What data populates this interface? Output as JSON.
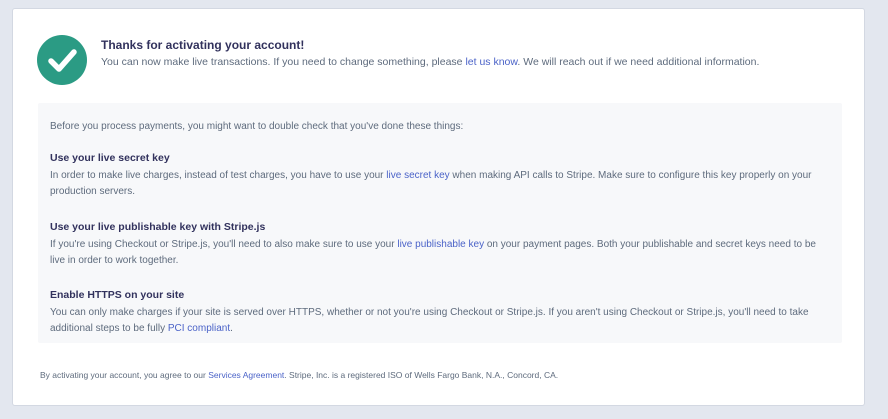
{
  "header": {
    "title": "Thanks for activating your account!",
    "subtitle_before": "You can now make live transactions. If you need to change something, please ",
    "subtitle_link": "let us know",
    "subtitle_after": ". We will reach out if we need additional information."
  },
  "checklist": {
    "intro": "Before you process payments, you might want to double check that you've done these things:",
    "items": [
      {
        "title": "Use your live secret key",
        "text_before": "In order to make live charges, instead of test charges, you have to use your ",
        "link": "live secret key",
        "text_after": " when making API calls to Stripe. Make sure to configure this key properly on your production servers."
      },
      {
        "title": "Use your live publishable key with Stripe.js",
        "text_before": "If you're using Checkout or Stripe.js, you'll need to also make sure to use your ",
        "link": "live publishable key",
        "text_after": " on your payment pages. Both your publishable and secret keys need to be live in order to work together."
      },
      {
        "title": "Enable HTTPS on your site",
        "text_before": "You can only make charges if your site is served over HTTPS, whether or not you're using Checkout or Stripe.js. If you aren't using Checkout or Stripe.js, you'll need to take additional steps to be fully ",
        "link": "PCI compliant",
        "text_after": "."
      }
    ]
  },
  "footer": {
    "text_before": "By activating your account, you agree to our ",
    "link": "Services Agreement",
    "text_after": ". Stripe, Inc. is a registered ISO of Wells Fargo Bank, N.A., Concord, CA."
  },
  "colors": {
    "success": "#2b9b84",
    "link": "#4b63c8",
    "heading": "#32325d",
    "body_text": "#5e6b7d"
  },
  "icons": {
    "status": "checkmark-circle-icon"
  }
}
